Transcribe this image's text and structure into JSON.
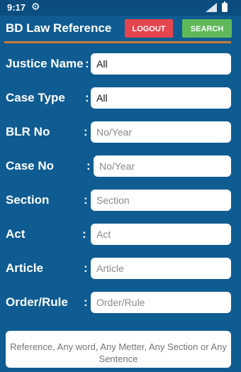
{
  "status_bar": {
    "time": "9:17",
    "settings_icon": "gear-icon",
    "signal_icon": "signal-icon",
    "battery_icon": "battery-icon"
  },
  "header": {
    "title": "BD Law Reference",
    "logout_label": "LOGOUT",
    "search_label": "SEARCH"
  },
  "colors": {
    "background": "#0f5c92",
    "logout": "#e5454f",
    "search": "#5fb85a",
    "divider": "#c87a3b"
  },
  "form": {
    "fields": [
      {
        "label": "Justice Name",
        "colon": ":",
        "value": "All",
        "placeholder": ""
      },
      {
        "label": "Case Type",
        "colon": ":",
        "value": "All",
        "placeholder": ""
      },
      {
        "label": "BLR No",
        "colon": ":",
        "value": "",
        "placeholder": "No/Year"
      },
      {
        "label": "Case No",
        "colon": ":",
        "value": "",
        "placeholder": "No/Year"
      },
      {
        "label": "Section",
        "colon": ":",
        "value": "",
        "placeholder": "Section"
      },
      {
        "label": "Act",
        "colon": ":",
        "value": "",
        "placeholder": "Act"
      },
      {
        "label": "Article",
        "colon": ":",
        "value": "",
        "placeholder": "Article"
      },
      {
        "label": "Order/Rule",
        "colon": ":",
        "value": "",
        "placeholder": "Order/Rule"
      }
    ],
    "reference_placeholder": "Reference, Any word, Any Metter, Any Section or Any Sentence"
  }
}
